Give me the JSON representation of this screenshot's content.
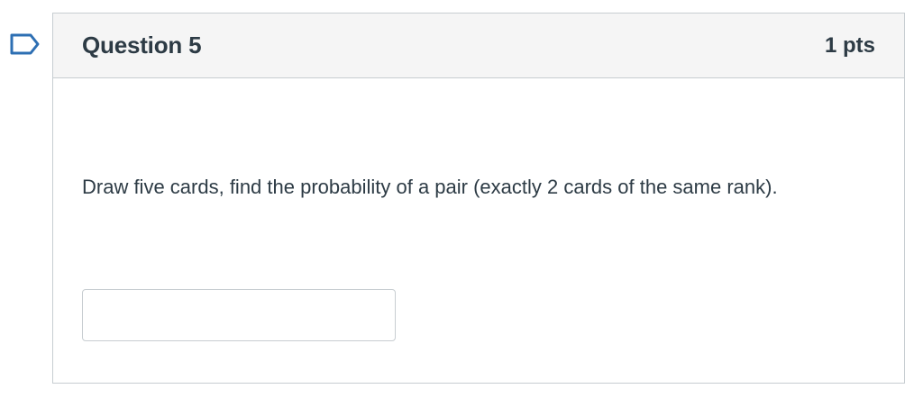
{
  "question": {
    "title": "Question 5",
    "points": "1 pts",
    "text": "Draw five cards, find the probability of a pair (exactly 2 cards of the same rank).",
    "answer_value": "",
    "answer_placeholder": ""
  },
  "icons": {
    "flag": "bookmark-flag-icon"
  },
  "colors": {
    "flag_stroke": "#2d6fb3",
    "header_bg": "#f5f5f5",
    "border": "#c7cdd1",
    "text": "#2d3b45"
  }
}
